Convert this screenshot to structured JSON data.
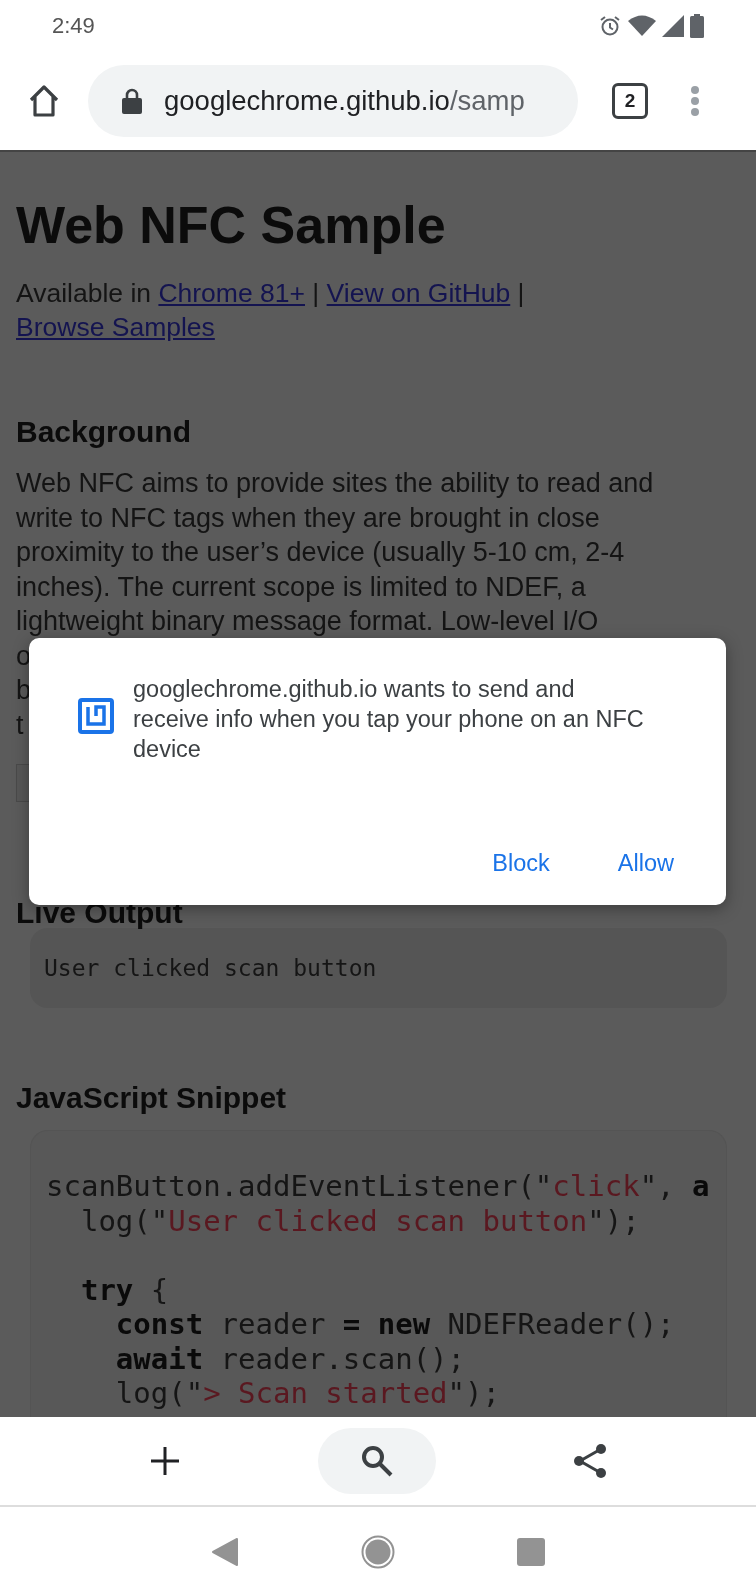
{
  "status_bar": {
    "time": "2:49"
  },
  "browser_toolbar": {
    "url_host": "googlechrome.github.io",
    "url_path": "/samp",
    "tab_count": "2"
  },
  "page": {
    "title": "Web NFC Sample",
    "availability": [
      {
        "kind": "text",
        "text": "Available in "
      },
      {
        "kind": "link",
        "text": "Chrome 81+"
      },
      {
        "kind": "text",
        "text": " | "
      },
      {
        "kind": "link",
        "text": "View on GitHub"
      },
      {
        "kind": "text",
        "text": " | "
      },
      {
        "kind": "link",
        "text": "Browse Samples"
      }
    ],
    "background_heading": "Background",
    "background_lines": [
      "Web NFC aims to provide sites the ability to read and",
      "write to NFC tags when they are brought in close",
      "proximity to the user’s device (usually 5-10 cm, 2-4",
      "inches). The current scope is limited to NDEF, a",
      "lightweight binary message format. Low-level I/O",
      "o",
      "b",
      "t"
    ],
    "live_output_heading": "Live Output",
    "live_output": "User clicked scan button",
    "snippet_heading": "JavaScript Snippet",
    "code_lines": [
      {
        "gap_before": false,
        "tokens": [
          {
            "kind": "plain",
            "text": "scanButton.addEventListener(\""
          },
          {
            "kind": "string",
            "text": "click"
          },
          {
            "kind": "plain",
            "text": "\", "
          },
          {
            "kind": "keyword",
            "text": "a"
          }
        ]
      },
      {
        "gap_before": false,
        "tokens": [
          {
            "kind": "plain",
            "text": "  log(\""
          },
          {
            "kind": "string",
            "text": "User clicked scan button"
          },
          {
            "kind": "plain",
            "text": "\");"
          }
        ]
      },
      {
        "gap_before": true,
        "tokens": [
          {
            "kind": "keyword",
            "text": "  try"
          },
          {
            "kind": "plain",
            "text": " {"
          }
        ]
      },
      {
        "gap_before": false,
        "tokens": [
          {
            "kind": "keyword",
            "text": "    const"
          },
          {
            "kind": "plain",
            "text": " reader "
          },
          {
            "kind": "keyword",
            "text": "="
          },
          {
            "kind": "keyword",
            "text": " new"
          },
          {
            "kind": "plain",
            "text": " NDEFReader();"
          }
        ]
      },
      {
        "gap_before": false,
        "tokens": [
          {
            "kind": "keyword",
            "text": "    await"
          },
          {
            "kind": "plain",
            "text": " reader.scan();"
          }
        ]
      },
      {
        "gap_before": false,
        "tokens": [
          {
            "kind": "plain",
            "text": "    log(\""
          },
          {
            "kind": "string",
            "text": "> Scan started"
          },
          {
            "kind": "plain",
            "text": "\");"
          }
        ]
      }
    ]
  },
  "permission_dialog": {
    "message": "googlechrome.github.io wants to send and receive info when you tap your phone on an NFC device",
    "buttons": [
      "Block",
      "Allow"
    ]
  }
}
